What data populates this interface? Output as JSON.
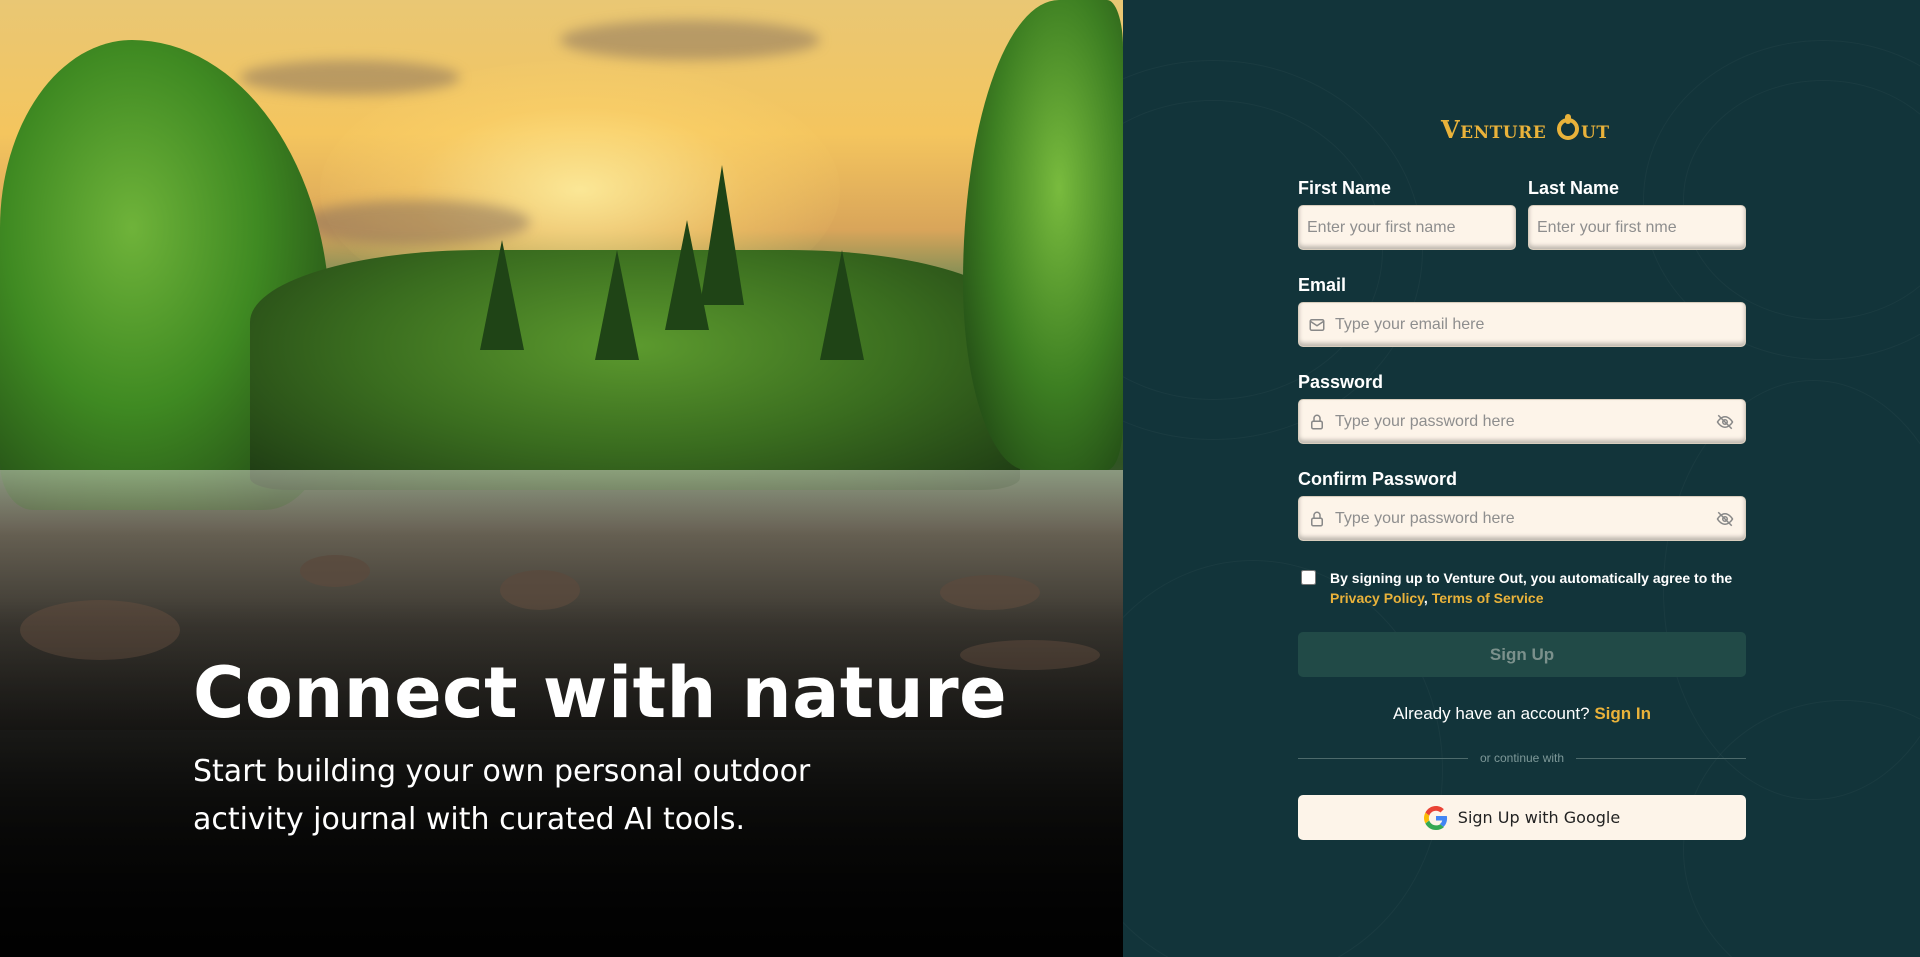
{
  "hero": {
    "title": "Connect with nature",
    "subtitle": "Start building your own personal outdoor activity journal with curated AI tools."
  },
  "brand": {
    "logo_prefix": "Venture ",
    "logo_suffix": "ut",
    "accent_color": "#e9b23a",
    "panel_color": "#12343a"
  },
  "form": {
    "first_name": {
      "label": "First Name",
      "placeholder": "Enter your first name",
      "value": ""
    },
    "last_name": {
      "label": "Last Name",
      "placeholder": "Enter your first nme",
      "value": ""
    },
    "email": {
      "label": "Email",
      "placeholder": "Type your email here",
      "icon": "mail-icon",
      "value": ""
    },
    "password": {
      "label": "Password",
      "placeholder": "Type your password here",
      "icon": "lock-icon",
      "toggle_icon": "eye-off-icon",
      "value": ""
    },
    "confirm_password": {
      "label": "Confirm Password",
      "placeholder": "Type your password here",
      "icon": "lock-icon",
      "toggle_icon": "eye-off-icon",
      "value": ""
    },
    "agreement": {
      "checked": false,
      "text": "By signing up to Venture Out, you automatically agree to the",
      "privacy_link": "Privacy Policy",
      "separator": ",",
      "terms_link": "Terms of Service"
    },
    "signup_button": "Sign Up",
    "have_account_text": "Already have an account?",
    "signin_link": "Sign In",
    "divider_text": "or continue with",
    "google_button": "Sign Up with Google"
  }
}
